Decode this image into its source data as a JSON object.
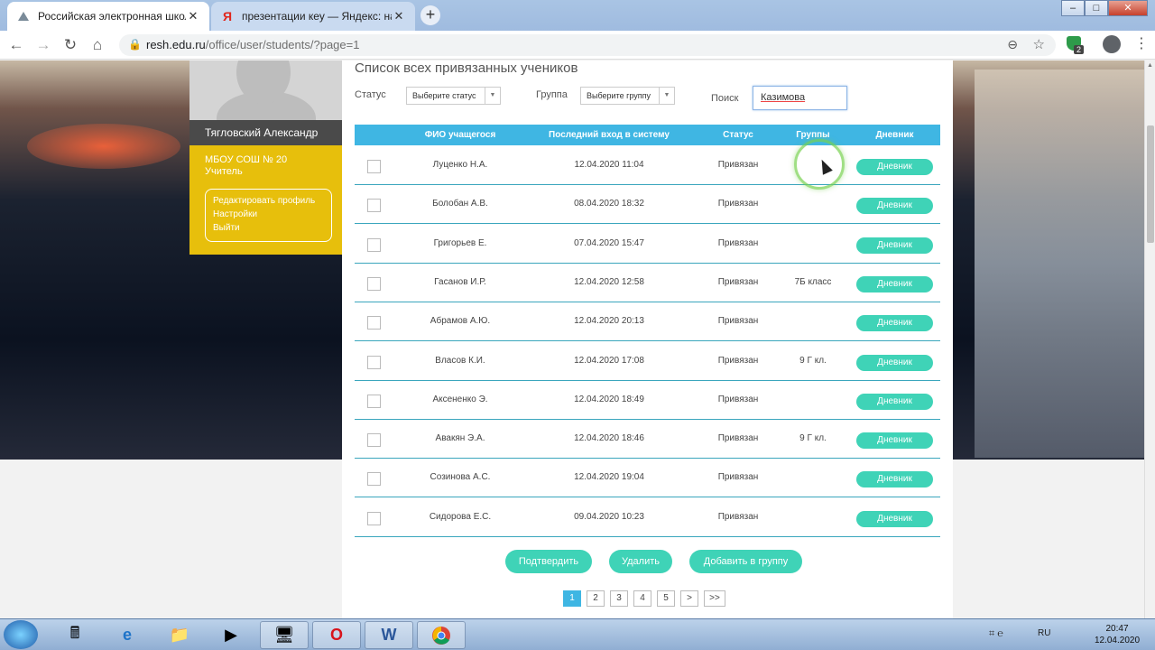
{
  "browser": {
    "tabs": [
      {
        "label": "Российская электронная школа",
        "active": true,
        "favicon": "resh-icon"
      },
      {
        "label": "презентации кеу — Яндекс: нашлось",
        "active": false,
        "favicon": "yandex-icon"
      }
    ],
    "url_host": "resh.edu.ru",
    "url_path": "/office/user/students/?page=1",
    "extension_badge": "2"
  },
  "sidebar": {
    "user_name": "Тягловский Александр",
    "school": "МБОУ СОШ № 20",
    "role": "Учитель",
    "links": [
      "Редактировать профиль",
      "Настройки",
      "Выйти"
    ]
  },
  "main": {
    "title": "Список всех привязанных учеников",
    "filters": {
      "status_label": "Статус",
      "status_value": "Выберите статус",
      "group_label": "Группа",
      "group_value": "Выберите группу",
      "search_label": "Поиск",
      "search_value": "Казимова"
    },
    "columns": [
      "ФИО учащегося",
      "Последний вход в систему",
      "Статус",
      "Группы",
      "Дневник"
    ],
    "rows": [
      {
        "name": "Луценко Н.А.",
        "last_login": "12.04.2020 11:04",
        "status": "Привязан",
        "group": "",
        "diary": "Дневник"
      },
      {
        "name": "Болобан А.В.",
        "last_login": "08.04.2020 18:32",
        "status": "Привязан",
        "group": "",
        "diary": "Дневник"
      },
      {
        "name": "Григорьев Е.",
        "last_login": "07.04.2020 15:47",
        "status": "Привязан",
        "group": "",
        "diary": "Дневник"
      },
      {
        "name": "Гасанов И.Р.",
        "last_login": "12.04.2020 12:58",
        "status": "Привязан",
        "group": "7Б класс",
        "diary": "Дневник"
      },
      {
        "name": "Абрамов А.Ю.",
        "last_login": "12.04.2020 20:13",
        "status": "Привязан",
        "group": "",
        "diary": "Дневник"
      },
      {
        "name": "Власов К.И.",
        "last_login": "12.04.2020 17:08",
        "status": "Привязан",
        "group": "9 Г кл.",
        "diary": "Дневник"
      },
      {
        "name": "Аксененко Э.",
        "last_login": "12.04.2020 18:49",
        "status": "Привязан",
        "group": "",
        "diary": "Дневник"
      },
      {
        "name": "Авакян Э.А.",
        "last_login": "12.04.2020 18:46",
        "status": "Привязан",
        "group": "9 Г кл.",
        "diary": "Дневник"
      },
      {
        "name": "Созинова А.С.",
        "last_login": "12.04.2020 19:04",
        "status": "Привязан",
        "group": "",
        "diary": "Дневник"
      },
      {
        "name": "Сидорова Е.С.",
        "last_login": "09.04.2020 10:23",
        "status": "Привязан",
        "group": "",
        "diary": "Дневник"
      }
    ],
    "actions": [
      "Подтвердить",
      "Удалить",
      "Добавить в группу"
    ],
    "pagination": [
      "1",
      "2",
      "3",
      "4",
      "5",
      ">",
      ">>"
    ],
    "current_page": "1"
  },
  "taskbar": {
    "apps": [
      "calculator-icon",
      "ie-icon",
      "explorer-icon",
      "media-player-icon",
      "network-icon",
      "opera-icon",
      "word-icon",
      "chrome-icon"
    ],
    "lang": "RU",
    "time": "20:47",
    "date": "12.04.2020"
  },
  "colors": {
    "accent": "#3fb6e3",
    "button": "#3fd3b7",
    "sidebar_yellow": "#e7bf0c"
  }
}
